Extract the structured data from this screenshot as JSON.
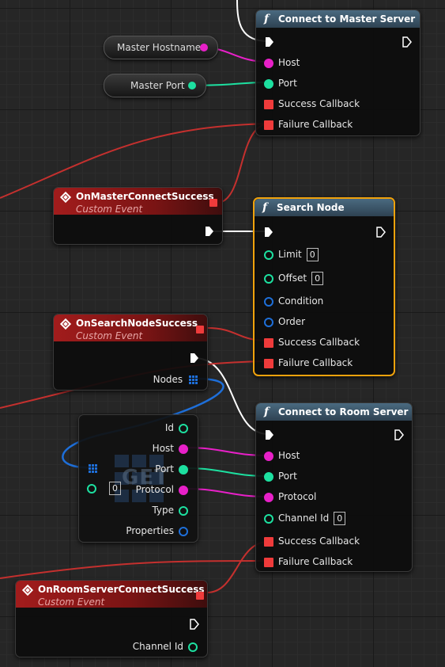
{
  "colors": {
    "exec": "#ffffff",
    "string_pin": "#e820c8",
    "int_pin": "#1de0a0",
    "struct_pin": "#1e6fd9",
    "delegate_pin": "#ef3b3b",
    "selected_outline": "#f0a20c"
  },
  "variables": {
    "master_hostname": "Master Hostname",
    "master_port": "Master Port"
  },
  "connect_master": {
    "title": "Connect to Master Server",
    "icon": "function-icon",
    "pins": {
      "host": "Host",
      "port": "Port",
      "success": "Success Callback",
      "failure": "Failure Callback"
    }
  },
  "event_master": {
    "title": "OnMasterConnectSuccess",
    "subtitle": "Custom Event"
  },
  "search_node": {
    "title": "Search Node",
    "icon": "function-icon",
    "pins": {
      "limit": "Limit",
      "limit_value": "0",
      "offset": "Offset",
      "offset_value": "0",
      "condition": "Condition",
      "order": "Order",
      "success": "Success Callback",
      "failure": "Failure Callback"
    }
  },
  "event_search": {
    "title": "OnSearchNodeSuccess",
    "subtitle": "Custom Event",
    "nodes_pin": "Nodes"
  },
  "get_node": {
    "watermark": "GET",
    "index_value": "0",
    "outputs": {
      "id": "Id",
      "host": "Host",
      "port": "Port",
      "protocol": "Protocol",
      "type": "Type",
      "properties": "Properties"
    }
  },
  "connect_room": {
    "title": "Connect to Room Server",
    "icon": "function-icon",
    "pins": {
      "host": "Host",
      "port": "Port",
      "protocol": "Protocol",
      "channel_id": "Channel Id",
      "channel_id_value": "0",
      "success": "Success Callback",
      "failure": "Failure Callback"
    }
  },
  "event_room": {
    "title": "OnRoomServerConnectSuccess",
    "subtitle": "Custom Event",
    "channel_pin": "Channel Id"
  }
}
